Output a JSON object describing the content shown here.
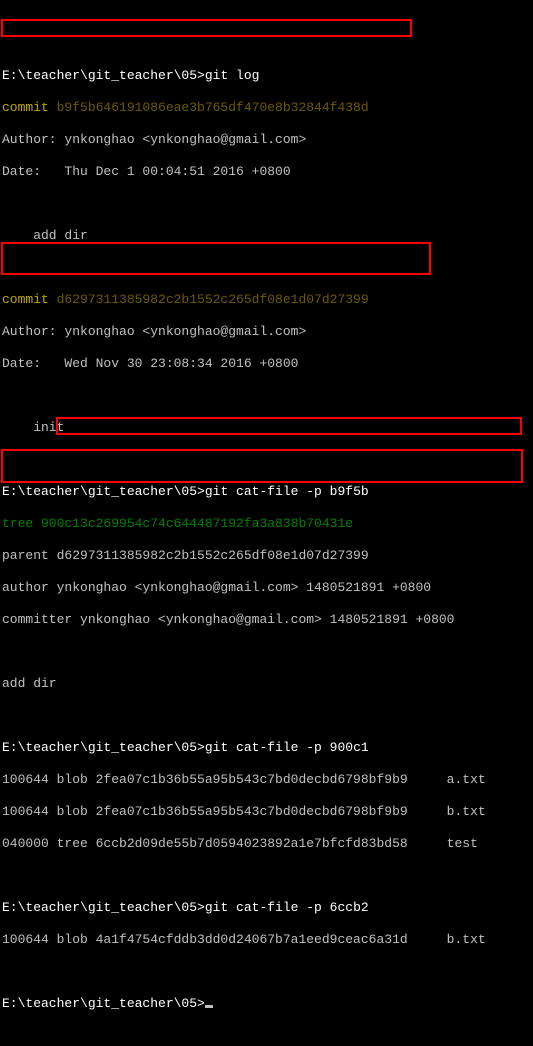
{
  "prompt1": "E:\\teacher\\git_teacher\\05>",
  "cmd1": "git log",
  "log1_commit_l": "commit ",
  "log1_commit_h": "b9f5b646191086eae3b765df470e8b32844f438d",
  "log1_author": "Author: ynkonghao <ynkonghao@gmail.com>",
  "log1_date": "Date:   Thu Dec 1 00:04:51 2016 +0800",
  "log1_msg": "    add dir",
  "log2_commit_l": "commit ",
  "log2_commit_h": "d6297311385982c2b1552c265df08e1d07d27399",
  "log2_author": "Author: ynkonghao <ynkonghao@gmail.com>",
  "log2_date": "Date:   Wed Nov 30 23:08:34 2016 +0800",
  "log2_msg": "    init",
  "prompt2": "E:\\teacher\\git_teacher\\05>",
  "cmd2": "git cat-file -p b9f5b",
  "tree1": "tree 900c13c269954c74c644487192fa3a838b70431e",
  "parent": "parent d6297311385982c2b1552c265df08e1d07d27399",
  "authorline": "author ynkonghao <ynkonghao@gmail.com> 1480521891 +0800",
  "committerline": "committer ynkonghao <ynkonghao@gmail.com> 1480521891 +0800",
  "msg_adddir": "add dir",
  "prompt3": "E:\\teacher\\git_teacher\\05>",
  "cmd3": "git cat-file -p 900c1",
  "ls1": "100644 blob 2fea07c1b36b55a95b543c7bd0decbd6798bf9b9     a.txt",
  "ls2": "100644 blob 2fea07c1b36b55a95b543c7bd0decbd6798bf9b9     b.txt",
  "ls3": "040000 tree 6ccb2d09de55b7d0594023892a1e7bfcfd83bd58     test",
  "prompt4": "E:\\teacher\\git_teacher\\05>",
  "cmd4": "git cat-file -p 6ccb2",
  "ls4": "100644 blob 4a1f4754cfddb3dd0d24067b7a1eed9ceac6a31d     b.txt",
  "prompt5": "E:\\teacher\\git_teacher\\05>"
}
